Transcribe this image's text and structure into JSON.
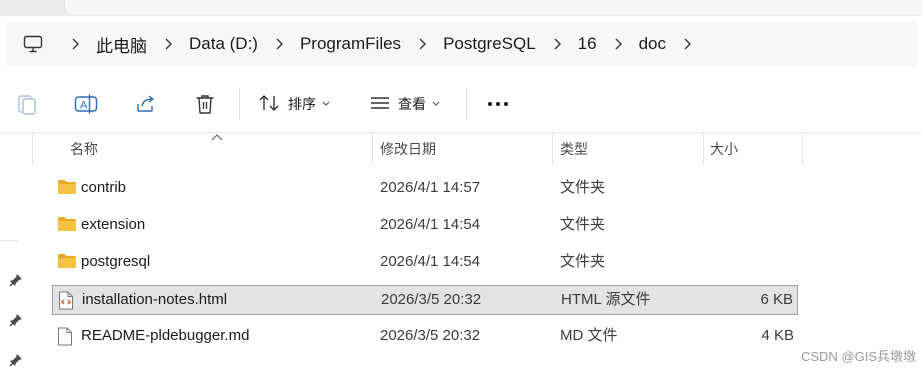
{
  "breadcrumb": {
    "items": [
      "此电脑",
      "Data (D:)",
      "ProgramFiles",
      "PostgreSQL",
      "16",
      "doc"
    ]
  },
  "toolbar": {
    "sort_label": "排序",
    "view_label": "查看"
  },
  "icons": {
    "pc": "computer-icon",
    "copy": "clipboard-icon",
    "rename": "rename-icon",
    "share": "share-icon",
    "delete": "trash-icon",
    "sort": "sort-icon",
    "view": "view-icon",
    "more": "more-icon",
    "folder": "folder-icon",
    "html_file": "html-file-icon",
    "text_file": "file-icon"
  },
  "columns": {
    "name": "名称",
    "date": "修改日期",
    "type": "类型",
    "size": "大小"
  },
  "files": [
    {
      "name": "contrib",
      "date": "2026/4/1 14:57",
      "type": "文件夹",
      "size": "",
      "icon": "folder-icon",
      "selected": false
    },
    {
      "name": "extension",
      "date": "2026/4/1 14:54",
      "type": "文件夹",
      "size": "",
      "icon": "folder-icon",
      "selected": false
    },
    {
      "name": "postgresql",
      "date": "2026/4/1 14:54",
      "type": "文件夹",
      "size": "",
      "icon": "folder-icon",
      "selected": false
    },
    {
      "name": "installation-notes.html",
      "date": "2026/3/5 20:32",
      "type": "HTML 源文件",
      "size": "6 KB",
      "icon": "html-file-icon",
      "selected": true
    },
    {
      "name": "README-pldebugger.md",
      "date": "2026/3/5 20:32",
      "type": "MD 文件",
      "size": "4 KB",
      "icon": "file-icon",
      "selected": false
    }
  ],
  "watermark": "CSDN @GIS兵墩墩",
  "colors": {
    "folder": "#f6c244",
    "selection_bg": "#e3e3e3",
    "selection_border": "#9e9e9e",
    "accent_icon": "#2b6cb0"
  }
}
